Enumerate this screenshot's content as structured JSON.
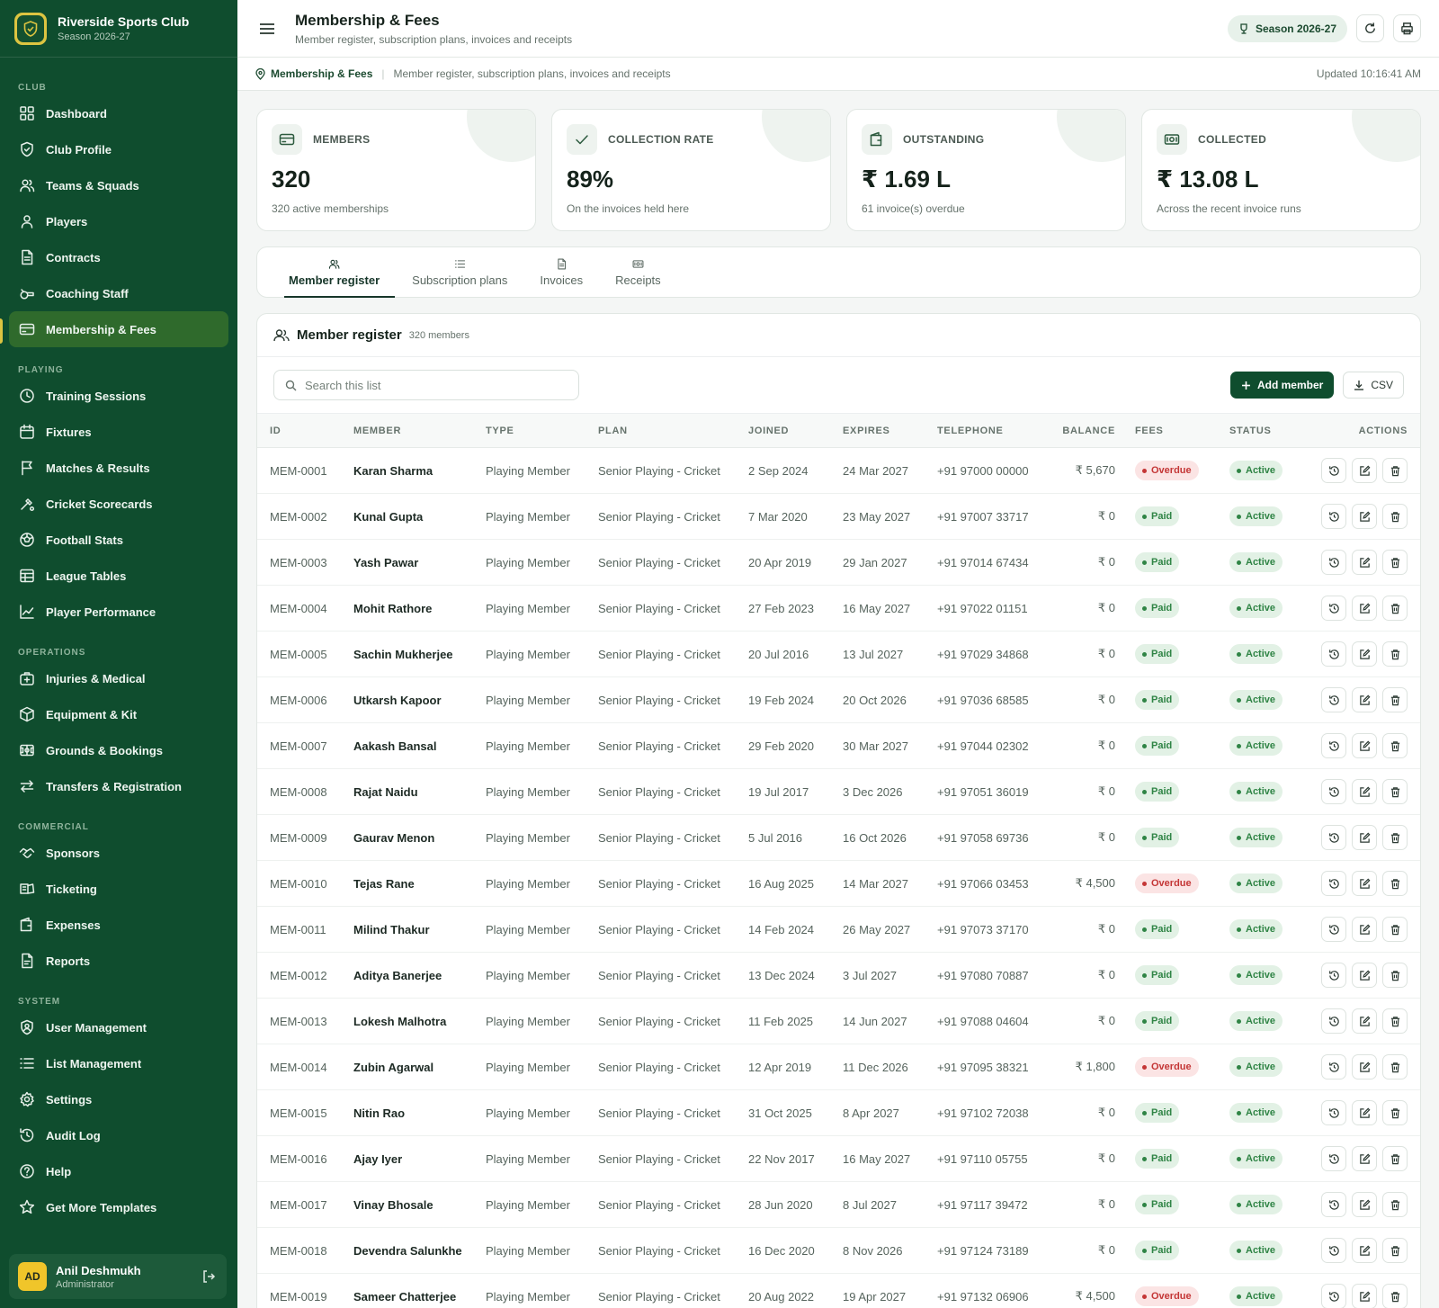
{
  "brand": {
    "name": "Riverside Sports Club",
    "season": "Season 2026-27"
  },
  "nav": [
    {
      "section": "CLUB",
      "items": [
        {
          "label": "Dashboard",
          "icon": "grid-icon"
        },
        {
          "label": "Club Profile",
          "icon": "shield-icon"
        },
        {
          "label": "Teams & Squads",
          "icon": "users-icon"
        },
        {
          "label": "Players",
          "icon": "user-icon"
        },
        {
          "label": "Contracts",
          "icon": "file-icon"
        },
        {
          "label": "Coaching Staff",
          "icon": "whistle-icon"
        },
        {
          "label": "Membership & Fees",
          "icon": "card-icon",
          "active": true
        }
      ]
    },
    {
      "section": "PLAYING",
      "items": [
        {
          "label": "Training Sessions",
          "icon": "clock-icon"
        },
        {
          "label": "Fixtures",
          "icon": "calendar-icon"
        },
        {
          "label": "Matches & Results",
          "icon": "flag-icon"
        },
        {
          "label": "Cricket Scorecards",
          "icon": "cricket-icon"
        },
        {
          "label": "Football Stats",
          "icon": "football-icon"
        },
        {
          "label": "League Tables",
          "icon": "table-icon"
        },
        {
          "label": "Player Performance",
          "icon": "chart-icon"
        }
      ]
    },
    {
      "section": "OPERATIONS",
      "items": [
        {
          "label": "Injuries & Medical",
          "icon": "medical-icon"
        },
        {
          "label": "Equipment & Kit",
          "icon": "box-icon"
        },
        {
          "label": "Grounds & Bookings",
          "icon": "stadium-icon"
        },
        {
          "label": "Transfers & Registration",
          "icon": "transfer-icon"
        }
      ]
    },
    {
      "section": "COMMERCIAL",
      "items": [
        {
          "label": "Sponsors",
          "icon": "handshake-icon"
        },
        {
          "label": "Ticketing",
          "icon": "ticket-icon"
        },
        {
          "label": "Expenses",
          "icon": "wallet-icon"
        },
        {
          "label": "Reports",
          "icon": "report-icon"
        }
      ]
    },
    {
      "section": "SYSTEM",
      "items": [
        {
          "label": "User Management",
          "icon": "user-shield-icon"
        },
        {
          "label": "List Management",
          "icon": "list-icon"
        },
        {
          "label": "Settings",
          "icon": "gear-icon"
        },
        {
          "label": "Audit Log",
          "icon": "history-icon"
        },
        {
          "label": "Help",
          "icon": "help-icon"
        },
        {
          "label": "Get More Templates",
          "icon": "star-icon"
        }
      ]
    }
  ],
  "user": {
    "initials": "AD",
    "name": "Anil Deshmukh",
    "role": "Administrator"
  },
  "header": {
    "title": "Membership & Fees",
    "subtitle": "Member register, subscription plans, invoices and receipts",
    "season": "Season 2026-27"
  },
  "breadcrumb": {
    "current": "Membership & Fees",
    "description": "Member register, subscription plans, invoices and receipts",
    "updated": "Updated 10:16:41 AM"
  },
  "kpis": [
    {
      "label": "MEMBERS",
      "value": "320",
      "note": "320 active memberships",
      "icon": "card-icon"
    },
    {
      "label": "COLLECTION RATE",
      "value": "89%",
      "note": "On the invoices held here",
      "icon": "check-icon"
    },
    {
      "label": "OUTSTANDING",
      "value": "₹ 1.69 L",
      "note": "61 invoice(s) overdue",
      "icon": "wallet-icon"
    },
    {
      "label": "COLLECTED",
      "value": "₹ 13.08 L",
      "note": "Across the recent invoice runs",
      "icon": "banknote-icon"
    }
  ],
  "tabs": [
    {
      "label": "Member register",
      "icon": "users-icon",
      "active": true
    },
    {
      "label": "Subscription plans",
      "icon": "list-icon"
    },
    {
      "label": "Invoices",
      "icon": "file-icon"
    },
    {
      "label": "Receipts",
      "icon": "banknote-icon"
    }
  ],
  "register": {
    "title": "Member register",
    "count": "320 members",
    "search_placeholder": "Search this list",
    "add_label": "Add member",
    "csv_label": "CSV",
    "columns": [
      "ID",
      "MEMBER",
      "TYPE",
      "PLAN",
      "JOINED",
      "EXPIRES",
      "TELEPHONE",
      "BALANCE",
      "FEES",
      "STATUS",
      "ACTIONS"
    ],
    "rows": [
      [
        "MEM-0001",
        "Karan Sharma",
        "Playing Member",
        "Senior Playing - Cricket",
        "2 Sep 2024",
        "24 Mar 2027",
        "+91 97000 00000",
        "₹ 5,670",
        "Overdue",
        "Active"
      ],
      [
        "MEM-0002",
        "Kunal Gupta",
        "Playing Member",
        "Senior Playing - Cricket",
        "7 Mar 2020",
        "23 May 2027",
        "+91 97007 33717",
        "₹ 0",
        "Paid",
        "Active"
      ],
      [
        "MEM-0003",
        "Yash Pawar",
        "Playing Member",
        "Senior Playing - Cricket",
        "20 Apr 2019",
        "29 Jan 2027",
        "+91 97014 67434",
        "₹ 0",
        "Paid",
        "Active"
      ],
      [
        "MEM-0004",
        "Mohit Rathore",
        "Playing Member",
        "Senior Playing - Cricket",
        "27 Feb 2023",
        "16 May 2027",
        "+91 97022 01151",
        "₹ 0",
        "Paid",
        "Active"
      ],
      [
        "MEM-0005",
        "Sachin Mukherjee",
        "Playing Member",
        "Senior Playing - Cricket",
        "20 Jul 2016",
        "13 Jul 2027",
        "+91 97029 34868",
        "₹ 0",
        "Paid",
        "Active"
      ],
      [
        "MEM-0006",
        "Utkarsh Kapoor",
        "Playing Member",
        "Senior Playing - Cricket",
        "19 Feb 2024",
        "20 Oct 2026",
        "+91 97036 68585",
        "₹ 0",
        "Paid",
        "Active"
      ],
      [
        "MEM-0007",
        "Aakash Bansal",
        "Playing Member",
        "Senior Playing - Cricket",
        "29 Feb 2020",
        "30 Mar 2027",
        "+91 97044 02302",
        "₹ 0",
        "Paid",
        "Active"
      ],
      [
        "MEM-0008",
        "Rajat Naidu",
        "Playing Member",
        "Senior Playing - Cricket",
        "19 Jul 2017",
        "3 Dec 2026",
        "+91 97051 36019",
        "₹ 0",
        "Paid",
        "Active"
      ],
      [
        "MEM-0009",
        "Gaurav Menon",
        "Playing Member",
        "Senior Playing - Cricket",
        "5 Jul 2016",
        "16 Oct 2026",
        "+91 97058 69736",
        "₹ 0",
        "Paid",
        "Active"
      ],
      [
        "MEM-0010",
        "Tejas Rane",
        "Playing Member",
        "Senior Playing - Cricket",
        "16 Aug 2025",
        "14 Mar 2027",
        "+91 97066 03453",
        "₹ 4,500",
        "Overdue",
        "Active"
      ],
      [
        "MEM-0011",
        "Milind Thakur",
        "Playing Member",
        "Senior Playing - Cricket",
        "14 Feb 2024",
        "26 May 2027",
        "+91 97073 37170",
        "₹ 0",
        "Paid",
        "Active"
      ],
      [
        "MEM-0012",
        "Aditya Banerjee",
        "Playing Member",
        "Senior Playing - Cricket",
        "13 Dec 2024",
        "3 Jul 2027",
        "+91 97080 70887",
        "₹ 0",
        "Paid",
        "Active"
      ],
      [
        "MEM-0013",
        "Lokesh Malhotra",
        "Playing Member",
        "Senior Playing - Cricket",
        "11 Feb 2025",
        "14 Jun 2027",
        "+91 97088 04604",
        "₹ 0",
        "Paid",
        "Active"
      ],
      [
        "MEM-0014",
        "Zubin Agarwal",
        "Playing Member",
        "Senior Playing - Cricket",
        "12 Apr 2019",
        "11 Dec 2026",
        "+91 97095 38321",
        "₹ 1,800",
        "Overdue",
        "Active"
      ],
      [
        "MEM-0015",
        "Nitin Rao",
        "Playing Member",
        "Senior Playing - Cricket",
        "31 Oct 2025",
        "8 Apr 2027",
        "+91 97102 72038",
        "₹ 0",
        "Paid",
        "Active"
      ],
      [
        "MEM-0016",
        "Ajay Iyer",
        "Playing Member",
        "Senior Playing - Cricket",
        "22 Nov 2017",
        "16 May 2027",
        "+91 97110 05755",
        "₹ 0",
        "Paid",
        "Active"
      ],
      [
        "MEM-0017",
        "Vinay Bhosale",
        "Playing Member",
        "Senior Playing - Cricket",
        "28 Jun 2020",
        "8 Jul 2027",
        "+91 97117 39472",
        "₹ 0",
        "Paid",
        "Active"
      ],
      [
        "MEM-0018",
        "Devendra Salunkhe",
        "Playing Member",
        "Senior Playing - Cricket",
        "16 Dec 2020",
        "8 Nov 2026",
        "+91 97124 73189",
        "₹ 0",
        "Paid",
        "Active"
      ],
      [
        "MEM-0019",
        "Sameer Chatterjee",
        "Playing Member",
        "Senior Playing - Cricket",
        "20 Aug 2022",
        "19 Apr 2027",
        "+91 97132 06906",
        "₹ 4,500",
        "Overdue",
        "Active"
      ]
    ]
  },
  "colors": {
    "sidebar": "#0f4d2e",
    "accent": "#dcc441",
    "paid": "#2f8445",
    "overdue": "#c43636",
    "primary_button": "#0f4d2e"
  }
}
